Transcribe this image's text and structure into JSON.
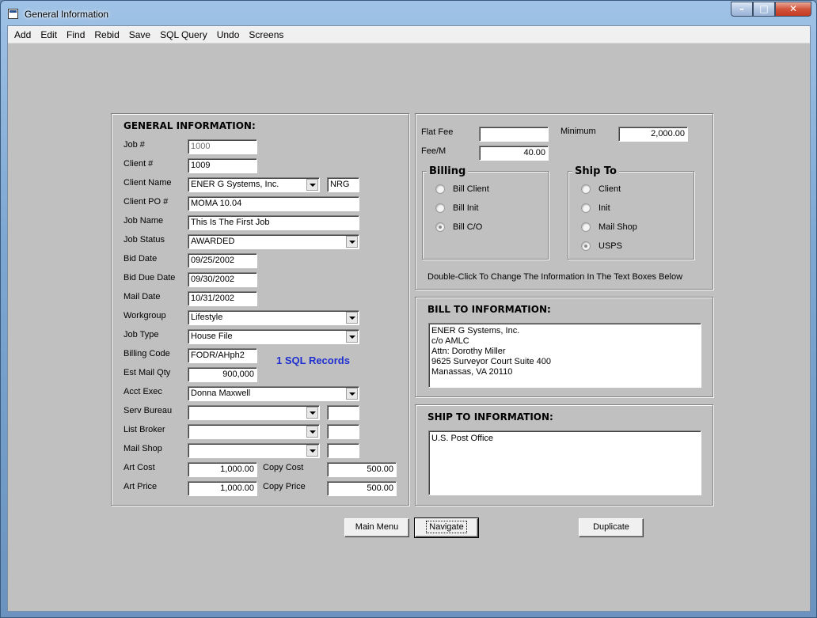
{
  "window": {
    "title": "General Information"
  },
  "menu": [
    "Add",
    "Edit",
    "Find",
    "Rebid",
    "Save",
    "SQL Query",
    "Undo",
    "Screens"
  ],
  "general": {
    "heading": "GENERAL INFORMATION:",
    "job_no_label": "Job #",
    "job_no": "1000",
    "client_no_label": "Client #",
    "client_no": "1009",
    "client_name_label": "Client Name",
    "client_name": "ENER G Systems, Inc.",
    "client_code": "NRG",
    "client_po_label": "Client PO #",
    "client_po": "MOMA 10.04",
    "job_name_label": "Job Name",
    "job_name": "This Is The First Job",
    "job_status_label": "Job Status",
    "job_status": "AWARDED",
    "bid_date_label": "Bid Date",
    "bid_date": "09/25/2002",
    "bid_due_label": "Bid Due Date",
    "bid_due": "09/30/2002",
    "mail_date_label": "Mail Date",
    "mail_date": "10/31/2002",
    "workgroup_label": "Workgroup",
    "workgroup": "Lifestyle",
    "job_type_label": "Job Type",
    "job_type": "House File",
    "billing_code_label": "Billing Code",
    "billing_code": "FODR/AHph2",
    "sql_records": "1 SQL Records",
    "est_mail_qty_label": "Est Mail Qty",
    "est_mail_qty": "900,000",
    "acct_exec_label": "Acct Exec",
    "acct_exec": "Donna Maxwell",
    "serv_bureau_label": "Serv Bureau",
    "serv_bureau": "",
    "serv_bureau_code": "",
    "list_broker_label": "List Broker",
    "list_broker": "",
    "list_broker_code": "",
    "mail_shop_label": "Mail Shop",
    "mail_shop": "",
    "mail_shop_code": "",
    "art_cost_label": "Art Cost",
    "art_cost": "1,000.00",
    "copy_cost_label": "Copy Cost",
    "copy_cost": "500.00",
    "art_price_label": "Art Price",
    "art_price": "1,000.00",
    "copy_price_label": "Copy Price",
    "copy_price": "500.00"
  },
  "fees": {
    "flat_fee_label": "Flat Fee",
    "flat_fee": "",
    "minimum_label": "Minimum",
    "minimum": "2,000.00",
    "fee_m_label": "Fee/M",
    "fee_m": "40.00",
    "billing_title": "Billing",
    "billing_options": [
      "Bill Client",
      "Bill Init",
      "Bill C/O"
    ],
    "billing_selected": "Bill C/O",
    "ship_title": "Ship To",
    "ship_options": [
      "Client",
      "Init",
      "Mail Shop",
      "USPS"
    ],
    "ship_selected": "USPS",
    "hint": "Double-Click To Change The Information In The Text Boxes Below"
  },
  "bill_to": {
    "heading": "BILL TO INFORMATION:",
    "lines": [
      "ENER G Systems, Inc.",
      "c/o AMLC",
      "Attn: Dorothy Miller",
      "9625 Surveyor Court Suite 400",
      "Manassas, VA 20110"
    ]
  },
  "ship_to": {
    "heading": "SHIP TO INFORMATION:",
    "lines": [
      "U.S. Post Office"
    ]
  },
  "buttons": {
    "main_menu": "Main Menu",
    "navigate": "Navigate",
    "duplicate": "Duplicate"
  }
}
